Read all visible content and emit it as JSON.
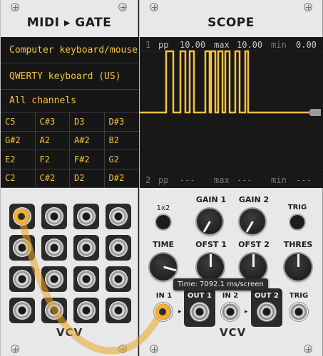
{
  "midi_gate": {
    "title": "MIDI ▸ GATE",
    "driver": "Computer keyboard/mouse",
    "device": "QWERTY keyboard (US)",
    "channel": "All channels",
    "notes": [
      "C5",
      "C#3",
      "D3",
      "D#3",
      "G#2",
      "A2",
      "A#2",
      "B2",
      "E2",
      "F2",
      "F#2",
      "G2",
      "C2",
      "C#2",
      "D2",
      "D#2"
    ],
    "logo": "VCV"
  },
  "scope": {
    "title": "SCOPE",
    "ch1": {
      "num": "1",
      "pp_label": "pp",
      "pp": "10.00",
      "max_label": "max",
      "max": "10.00",
      "min_label": "min",
      "min": "0.00"
    },
    "ch2": {
      "num": "2",
      "pp_label": "pp",
      "pp": "---",
      "max_label": "max",
      "max": "---",
      "min_label": "min",
      "min": "---"
    },
    "mode_label": "1x2",
    "gain1_label": "GAIN 1",
    "gain2_label": "GAIN 2",
    "trig_label": "TRIG",
    "time_label": "TIME",
    "ofst1_label": "OFST 1",
    "ofst2_label": "OFST 2",
    "thres_label": "THRES",
    "in1_label": "IN 1",
    "out1_label": "OUT 1",
    "in2_label": "IN 2",
    "out2_label": "OUT 2",
    "trig_in_label": "TRIG",
    "logo": "VCV"
  },
  "tooltip": "Time: 7092.1 ms/screen",
  "colors": {
    "display_text": "#f5c242",
    "trace": "#f5c242",
    "cable": "#f0b030"
  }
}
